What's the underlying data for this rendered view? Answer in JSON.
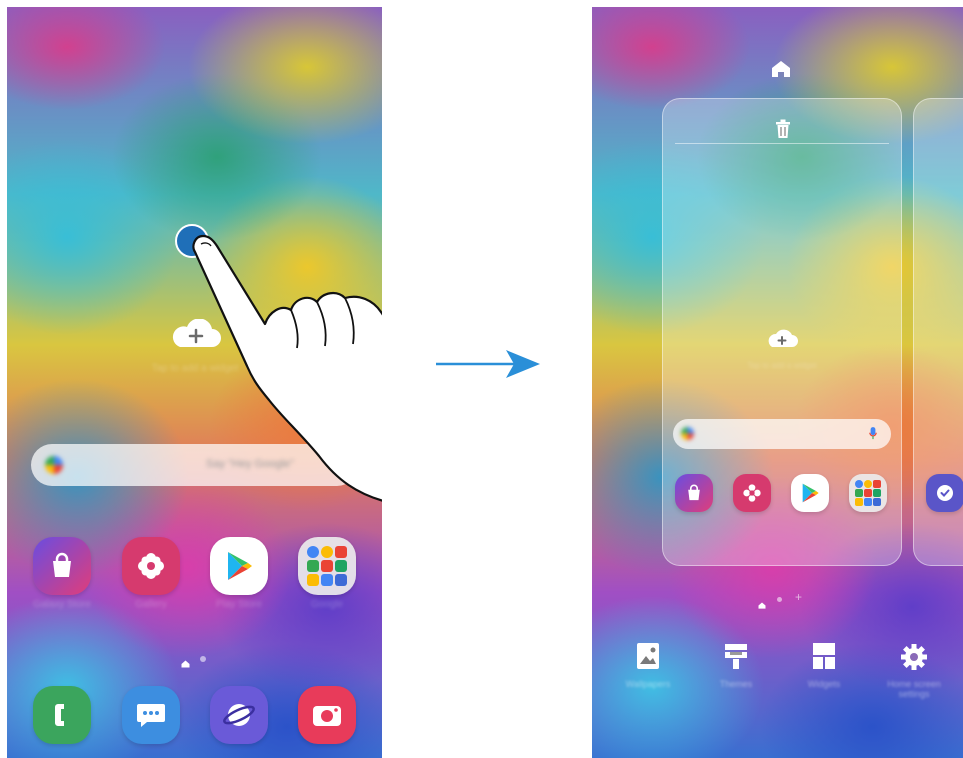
{
  "left_screen": {
    "add_widget_label": "Tap to add a widget",
    "search": {
      "placeholder": "Say \"Hey Google\""
    },
    "apps": [
      {
        "name": "shopping-bag",
        "label": "Galaxy Store",
        "color": "#7a4fd6"
      },
      {
        "name": "flower",
        "label": "Gallery",
        "color": "#d63a6e"
      },
      {
        "name": "play-store",
        "label": "Play Store",
        "color": "#ffffff"
      },
      {
        "name": "google-folder",
        "label": "Google",
        "color": "#e6e6e6"
      }
    ],
    "dock": [
      {
        "name": "phone",
        "label": "Phone",
        "color": "#3ba55d"
      },
      {
        "name": "messages",
        "label": "Messages",
        "color": "#3d8ee0"
      },
      {
        "name": "internet",
        "label": "Internet",
        "color": "#6a5ad8"
      },
      {
        "name": "camera",
        "label": "Camera",
        "color": "#e83b5a"
      }
    ]
  },
  "right_screen": {
    "panel_add_label": "Tap to add a widget",
    "tools": [
      {
        "name": "wallpapers",
        "label": "Wallpapers"
      },
      {
        "name": "themes",
        "label": "Themes"
      },
      {
        "name": "widgets",
        "label": "Widgets"
      },
      {
        "name": "settings",
        "label": "Home screen settings"
      }
    ]
  },
  "colors": {
    "arrow": "#2a8fd8",
    "touch_point": "#1f6fb8"
  }
}
